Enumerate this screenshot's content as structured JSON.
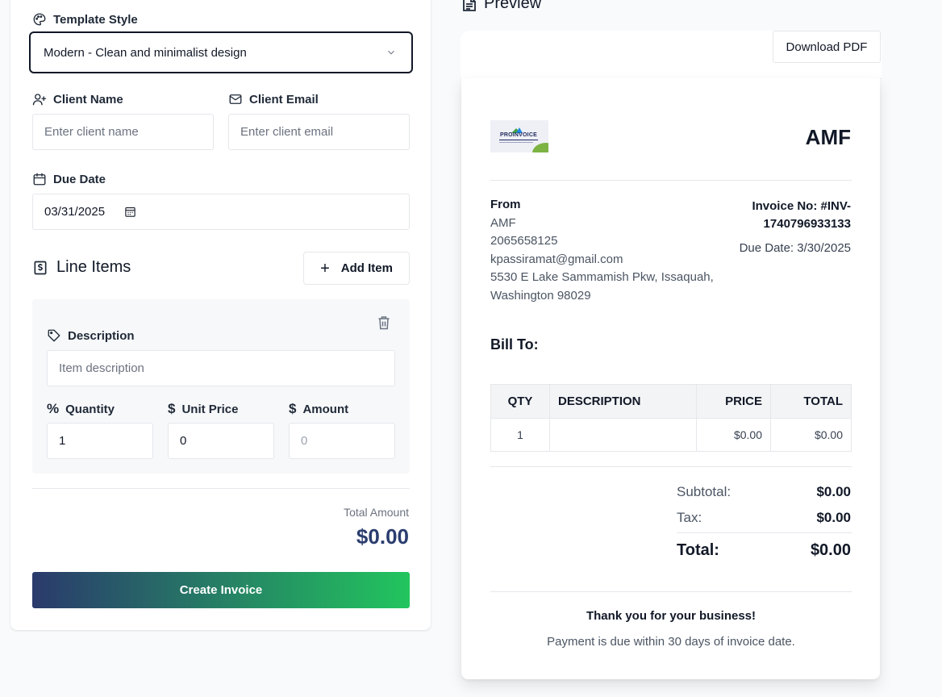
{
  "form": {
    "template_style": {
      "label": "Template Style",
      "value": "Modern - Clean and minimalist design",
      "icon": "palette-icon"
    },
    "client_name": {
      "label": "Client Name",
      "placeholder": "Enter client name",
      "icon": "user-plus-icon"
    },
    "client_email": {
      "label": "Client Email",
      "placeholder": "Enter client email",
      "icon": "mail-icon"
    },
    "due_date": {
      "label": "Due Date",
      "value": "03/31/2025",
      "icon": "calendar-icon"
    },
    "line_items": {
      "title": "Line Items",
      "add_label": "Add Item",
      "items": [
        {
          "description_label": "Description",
          "description_placeholder": "Item description",
          "quantity_label": "Quantity",
          "quantity_value": "1",
          "unit_price_label": "Unit Price",
          "unit_price_value": "0",
          "amount_label": "Amount",
          "amount_value": "0"
        }
      ]
    },
    "total_label": "Total Amount",
    "total_value": "$0.00",
    "create_label": "Create Invoice",
    "colors": {
      "gradient_start": "#2a3a6c",
      "gradient_end": "#22c55e",
      "total_text": "#2a3d6e"
    }
  },
  "preview": {
    "title": "Preview",
    "download_label": "Download PDF",
    "invoice": {
      "logo_text": "PROINVOICE",
      "company": "AMF",
      "from_label": "From",
      "from_lines": [
        "AMF",
        "2065658125",
        "kpassiramat@gmail.com",
        "5530 E Lake Sammamish Pkw, Issaquah,",
        "Washington 98029"
      ],
      "invoice_no": "Invoice No: #INV-1740796933133",
      "due_date": "Due Date: 3/30/2025",
      "bill_to_label": "Bill To:",
      "table": {
        "headers": [
          "QTY",
          "DESCRIPTION",
          "PRICE",
          "TOTAL"
        ],
        "rows": [
          [
            "1",
            "",
            "$0.00",
            "$0.00"
          ]
        ]
      },
      "subtotal_label": "Subtotal:",
      "subtotal_value": "$0.00",
      "tax_label": "Tax:",
      "tax_value": "$0.00",
      "total_label": "Total:",
      "total_value": "$0.00",
      "thanks": "Thank you for your business!",
      "terms": "Payment is due within 30 days of invoice date."
    }
  }
}
